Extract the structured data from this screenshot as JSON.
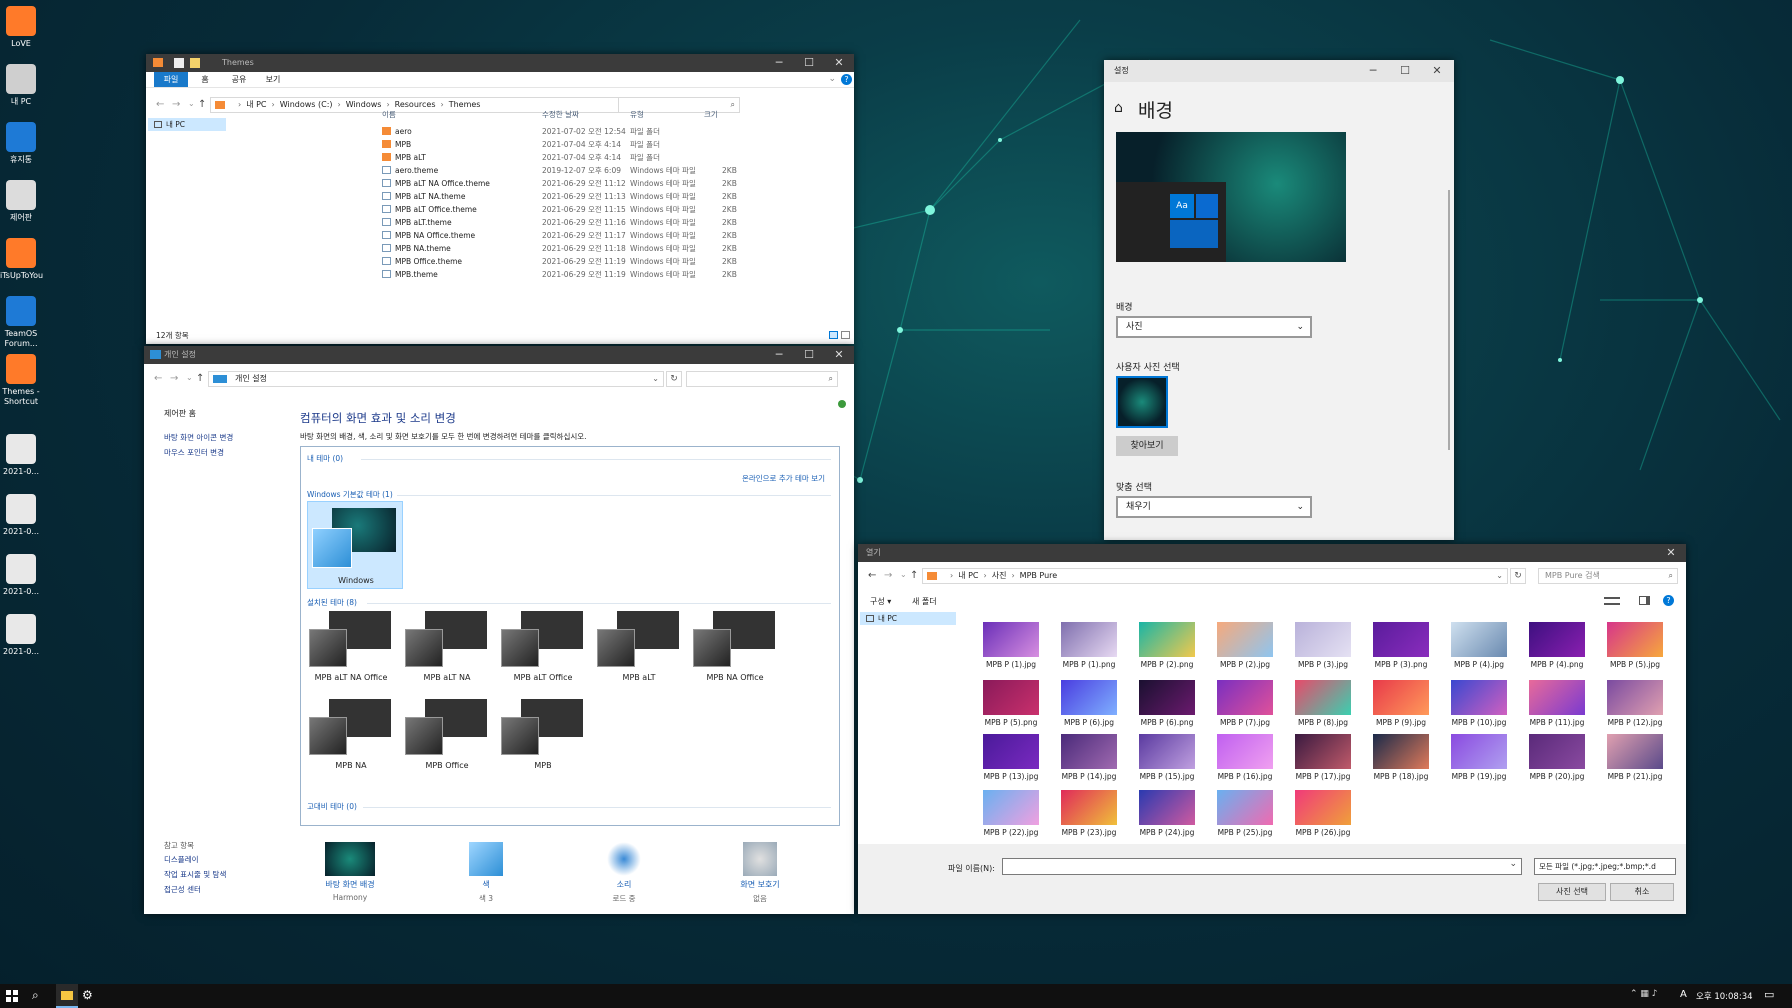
{
  "desktop": {
    "icons": [
      {
        "label": "LoVE",
        "color": "#ff7a29"
      },
      {
        "label": "내 PC",
        "color": "#cfcfcf"
      },
      {
        "label": "휴지통",
        "color": "#1e7ad6"
      },
      {
        "label": "제어판",
        "color": "#dcdcdc"
      },
      {
        "label": "iTsUpToYou",
        "color": "#ff7a29"
      },
      {
        "label": "TeamOS Forum...",
        "color": "#1e7ad6"
      },
      {
        "label": "Themes - Shortcut",
        "color": "#ff7a29"
      },
      {
        "label": "2021-0...",
        "color": "#e8e8e8"
      },
      {
        "label": "2021-0...",
        "color": "#e8e8e8"
      },
      {
        "label": "2021-0...",
        "color": "#e8e8e8"
      },
      {
        "label": "2021-0...",
        "color": "#e8e8e8"
      }
    ]
  },
  "explorer": {
    "title": "Themes",
    "tabs": [
      "파일",
      "홈",
      "공유",
      "보기"
    ],
    "path": [
      "내 PC",
      "Windows (C:)",
      "Windows",
      "Resources",
      "Themes"
    ],
    "nav_item": "내 PC",
    "columns": [
      "이름",
      "수정한 날짜",
      "유형",
      "크기"
    ],
    "files": [
      {
        "name": "aero",
        "date": "2021-07-02 오전 12:54",
        "type": "파일 폴더",
        "size": "",
        "kind": "folder"
      },
      {
        "name": "MPB",
        "date": "2021-07-04 오후 4:14",
        "type": "파일 폴더",
        "size": "",
        "kind": "folder"
      },
      {
        "name": "MPB aLT",
        "date": "2021-07-04 오후 4:14",
        "type": "파일 폴더",
        "size": "",
        "kind": "folder"
      },
      {
        "name": "aero.theme",
        "date": "2019-12-07 오후 6:09",
        "type": "Windows 테마 파일",
        "size": "2KB",
        "kind": "file"
      },
      {
        "name": "MPB aLT NA Office.theme",
        "date": "2021-06-29 오전 11:12",
        "type": "Windows 테마 파일",
        "size": "2KB",
        "kind": "file"
      },
      {
        "name": "MPB aLT NA.theme",
        "date": "2021-06-29 오전 11:13",
        "type": "Windows 테마 파일",
        "size": "2KB",
        "kind": "file"
      },
      {
        "name": "MPB aLT Office.theme",
        "date": "2021-06-29 오전 11:15",
        "type": "Windows 테마 파일",
        "size": "2KB",
        "kind": "file"
      },
      {
        "name": "MPB aLT.theme",
        "date": "2021-06-29 오전 11:16",
        "type": "Windows 테마 파일",
        "size": "2KB",
        "kind": "file"
      },
      {
        "name": "MPB NA Office.theme",
        "date": "2021-06-29 오전 11:17",
        "type": "Windows 테마 파일",
        "size": "2KB",
        "kind": "file"
      },
      {
        "name": "MPB NA.theme",
        "date": "2021-06-29 오전 11:18",
        "type": "Windows 테마 파일",
        "size": "2KB",
        "kind": "file"
      },
      {
        "name": "MPB Office.theme",
        "date": "2021-06-29 오전 11:19",
        "type": "Windows 테마 파일",
        "size": "2KB",
        "kind": "file"
      },
      {
        "name": "MPB.theme",
        "date": "2021-06-29 오전 11:19",
        "type": "Windows 테마 파일",
        "size": "2KB",
        "kind": "file"
      }
    ],
    "status": "12개 항목"
  },
  "personalize": {
    "title": "개인 설정",
    "path": "개인 설정",
    "sidebar": {
      "home": "제어판 홈",
      "links": [
        "바탕 화면 아이콘 변경",
        "마우스 포인터 변경"
      ],
      "see_also_title": "참고 항목",
      "see_also": [
        "디스플레이",
        "작업 표시줄 및 탐색",
        "접근성 센터"
      ]
    },
    "heading": "컴퓨터의 화면 효과 및 소리 변경",
    "desc": "바탕 화면의 배경, 색, 소리 및 화면 보호기를 모두 한 번에 변경하려면 테마를 클릭하십시오.",
    "my_themes": "내 테마 (0)",
    "online_link": "온라인으로 추가 테마 보기",
    "default_group": "Windows 기본값 테마 (1)",
    "default_theme": "Windows",
    "installed_group": "설치된 테마 (8)",
    "installed": [
      "MPB aLT NA Office",
      "MPB aLT NA",
      "MPB aLT Office",
      "MPB aLT",
      "MPB NA Office",
      "MPB NA",
      "MPB Office",
      "MPB"
    ],
    "hc_group": "고대비 테마 (0)",
    "bottom": [
      {
        "label": "바탕 화면 배경",
        "sub": "Harmony"
      },
      {
        "label": "색",
        "sub": "색 3"
      },
      {
        "label": "소리",
        "sub": "로드 중"
      },
      {
        "label": "화면 보호기",
        "sub": "없음"
      }
    ]
  },
  "settings": {
    "app_title": "설정",
    "page_title": "배경",
    "background_label": "배경",
    "background_value": "사진",
    "choose_label": "사용자 사진 선택",
    "browse": "찾아보기",
    "fit_label": "맞춤 선택",
    "fit_value": "채우기",
    "preview_tile_text": "Aa"
  },
  "open_dialog": {
    "title": "열기",
    "path": [
      "내 PC",
      "사진",
      "MPB Pure"
    ],
    "search_placeholder": "MPB Pure 검색",
    "organize": "구성 ▾",
    "new_folder": "새 폴더",
    "nav_item": "내 PC",
    "files": [
      {
        "name": "MPB P (1).jpg",
        "c1": "#6a2fb8",
        "c2": "#d78fe0"
      },
      {
        "name": "MPB P (1).png",
        "c1": "#7f6fae",
        "c2": "#e7d9f2"
      },
      {
        "name": "MPB P (2).png",
        "c1": "#19b5a6",
        "c2": "#f2c94c"
      },
      {
        "name": "MPB P (2).jpg",
        "c1": "#f6a97c",
        "c2": "#8ec5f0"
      },
      {
        "name": "MPB P (3).jpg",
        "c1": "#b9b2da",
        "c2": "#e5e1f3"
      },
      {
        "name": "MPB P (3).png",
        "c1": "#5a1c9c",
        "c2": "#8a2dbd"
      },
      {
        "name": "MPB P (4).jpg",
        "c1": "#cfe0ef",
        "c2": "#6a8ab0"
      },
      {
        "name": "MPB P (4).png",
        "c1": "#3d1080",
        "c2": "#8a1fb0"
      },
      {
        "name": "MPB P (5).jpg",
        "c1": "#d6358a",
        "c2": "#f7a83c"
      },
      {
        "name": "MPB P (5).png",
        "c1": "#8a1a5a",
        "c2": "#c9306c"
      },
      {
        "name": "MPB P (6).jpg",
        "c1": "#4a3de0",
        "c2": "#7fb0ff"
      },
      {
        "name": "MPB P (6).png",
        "c1": "#1a1030",
        "c2": "#6b1a6e"
      },
      {
        "name": "MPB P (7).jpg",
        "c1": "#7a2fc0",
        "c2": "#e0519a"
      },
      {
        "name": "MPB P (8).jpg",
        "c1": "#e84a6a",
        "c2": "#3ad0b0"
      },
      {
        "name": "MPB P (9).jpg",
        "c1": "#e83a4a",
        "c2": "#ff9a5a"
      },
      {
        "name": "MPB P (10).jpg",
        "c1": "#3a48d0",
        "c2": "#d060c0"
      },
      {
        "name": "MPB P (11).jpg",
        "c1": "#e86a9a",
        "c2": "#7a3ad0"
      },
      {
        "name": "MPB P (12).jpg",
        "c1": "#7a4aa0",
        "c2": "#e0a0b0"
      },
      {
        "name": "MPB P (13).jpg",
        "c1": "#4a1a9a",
        "c2": "#7a2ac0"
      },
      {
        "name": "MPB P (14).jpg",
        "c1": "#4a2a7a",
        "c2": "#a06ab0"
      },
      {
        "name": "MPB P (15).jpg",
        "c1": "#5a3aa0",
        "c2": "#c0a0e0"
      },
      {
        "name": "MPB P (16).jpg",
        "c1": "#c060f0",
        "c2": "#f0a0f0"
      },
      {
        "name": "MPB P (17).jpg",
        "c1": "#3a1a40",
        "c2": "#c05a6a"
      },
      {
        "name": "MPB P (18).jpg",
        "c1": "#1a2a4a",
        "c2": "#e07a5a"
      },
      {
        "name": "MPB P (19).jpg",
        "c1": "#8a4ae0",
        "c2": "#b0a0f0"
      },
      {
        "name": "MPB P (20).jpg",
        "c1": "#5a2a7a",
        "c2": "#8a4aa0"
      },
      {
        "name": "MPB P (21).jpg",
        "c1": "#e0a0b0",
        "c2": "#5a4a8a"
      },
      {
        "name": "MPB P (22).jpg",
        "c1": "#6ab0f0",
        "c2": "#f0a0e0"
      },
      {
        "name": "MPB P (23).jpg",
        "c1": "#e02a5a",
        "c2": "#f0c03a"
      },
      {
        "name": "MPB P (24).jpg",
        "c1": "#2a3ab0",
        "c2": "#d05aa0"
      },
      {
        "name": "MPB P (25).jpg",
        "c1": "#6ab0f0",
        "c2": "#f06ab0"
      },
      {
        "name": "MPB P (26).jpg",
        "c1": "#f03a7a",
        "c2": "#f0a03a"
      }
    ],
    "filename_label": "파일 이름(N):",
    "filter": "모든 파일 (*.jpg;*.jpeg;*.bmp;*.d",
    "ok": "사진 선택",
    "cancel": "취소"
  },
  "taskbar": {
    "clock": "오후 10:08:34",
    "ime": "A"
  },
  "colors": {
    "accent": "#0078d7",
    "link": "#1a5fb4",
    "folder": "#f58b36"
  }
}
